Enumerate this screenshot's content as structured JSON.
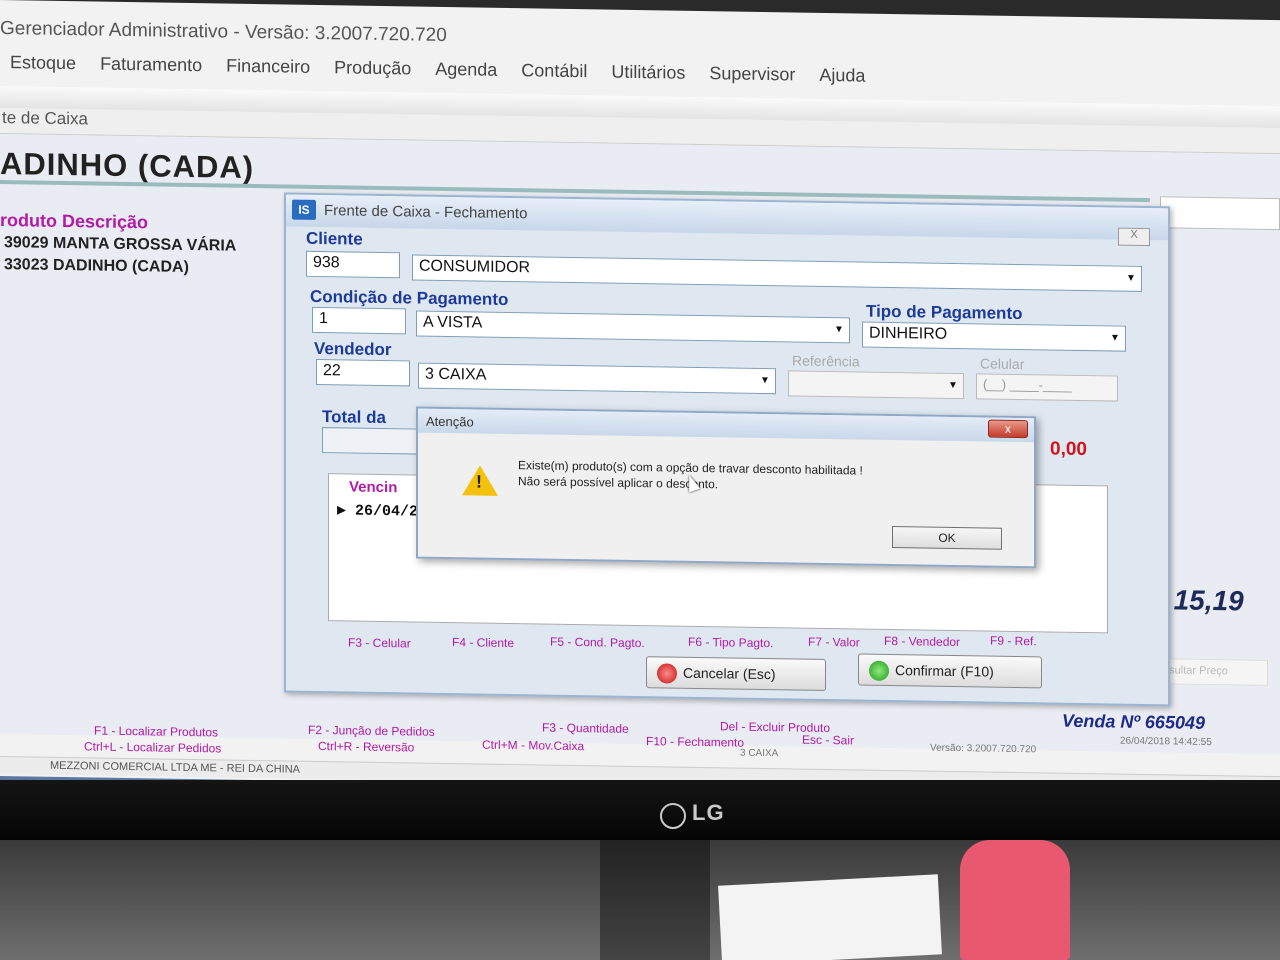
{
  "app": {
    "title": "Gerenciador Administrativo - Versão: 3.2007.720.720",
    "menu": [
      "Estoque",
      "Faturamento",
      "Financeiro",
      "Produção",
      "Agenda",
      "Contábil",
      "Utilitários",
      "Supervisor",
      "Ajuda"
    ],
    "subtitle": "te de Caixa"
  },
  "main": {
    "product_title": "ADINHO (CADA)",
    "products_header": "roduto Descrição",
    "products": [
      {
        "text": "39029  MANTA GROSSA VÁRIA"
      },
      {
        "text": "33023  DADINHO (CADA)"
      }
    ],
    "total": "R$ 15,19",
    "consult_button": "Consultar Preço",
    "footer_keys": [
      "F1 - Localizar Produtos",
      "F2 - Junção de Pedidos",
      "F3 - Quantidade",
      "Del - Excluir Produto",
      "Ctrl+L - Localizar Pedidos",
      "Ctrl+R - Reversão",
      "Ctrl+M - Mov.Caixa",
      "F10 - Fechamento",
      "Esc - Sair"
    ],
    "venda": "Venda Nº 665049",
    "venda_datetime": "26/04/2018 14:42:55",
    "version": "Versão: 3.2007.720.720",
    "caixa": "3 CAIXA",
    "status": "MEZZONI COMERCIAL LTDA ME  -  REI DA CHINA"
  },
  "dialog": {
    "title": "Frente de Caixa - Fechamento",
    "logo": "IS",
    "close_label": "X",
    "cliente_label": "Cliente",
    "cliente_code": "938",
    "cliente_name": "CONSUMIDOR",
    "condicao_label": "Condição de Pagamento",
    "condicao_code": "1",
    "condicao_name": "A VISTA",
    "tipo_label": "Tipo de Pagamento",
    "tipo_value": "DINHEIRO",
    "vendedor_label": "Vendedor",
    "vendedor_code": "22",
    "vendedor_name": "3 CAIXA",
    "referencia_label": "Referência",
    "celular_label": "Celular",
    "celular_placeholder": "(__) ____-____",
    "total_label": "Total da",
    "total_value": "0,00",
    "grid_header": "Vencin",
    "grid_row": "26/04/2",
    "fkeys": [
      "F3 - Celular",
      "F4 - Cliente",
      "F5 - Cond. Pagto.",
      "F6 - Tipo Pagto.",
      "F7 - Valor",
      "F8 - Vendedor",
      "F9 - Ref."
    ],
    "cancel_button": "Cancelar (Esc)",
    "confirm_button": "Confirmar (F10)"
  },
  "alert": {
    "title": "Atenção",
    "close_label": "x",
    "message_line1": "Existe(m) produto(s) com a opção de travar desconto habilitada !",
    "message_line2": "Não será possível aplicar o desconto.",
    "ok_label": "OK"
  },
  "monitor": {
    "brand": "LG"
  },
  "colors": {
    "label_blue": "#1d3a9a",
    "key_magenta": "#b31aa6",
    "total_red": "#d0141e",
    "warning_yellow": "#f4c20d"
  }
}
